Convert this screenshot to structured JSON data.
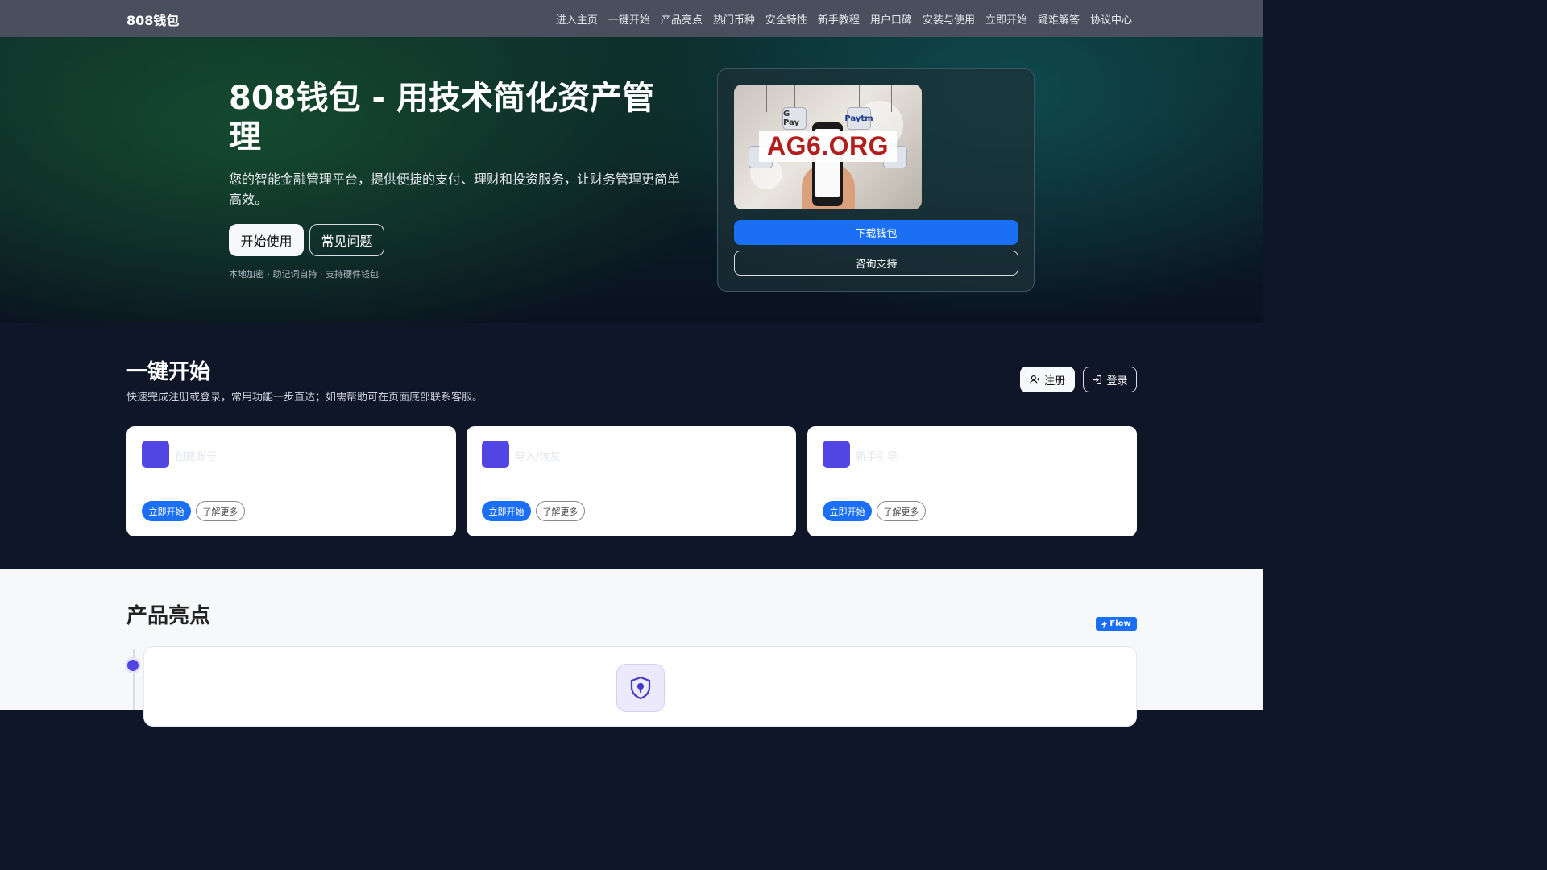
{
  "nav": {
    "brand": "808钱包",
    "links": [
      "进入主页",
      "一键开始",
      "产品亮点",
      "热门币种",
      "安全特性",
      "新手教程",
      "用户口碑",
      "安装与使用",
      "立即开始",
      "疑难解答",
      "协议中心"
    ]
  },
  "hero": {
    "title": "808钱包 - 用技术简化资产管理",
    "subtitle": "您的智能金融管理平台，提供便捷的支付、理财和投资服务，让财务管理更简单高效。",
    "start_label": "开始使用",
    "faq_label": "常见问题",
    "note": "本地加密 · 助记词自持 · 支持硬件钱包",
    "card": {
      "image_tags": [
        "G Pay",
        "Paytm"
      ],
      "watermark": "AG6.ORG",
      "download_label": "下载钱包",
      "support_label": "咨询支持"
    }
  },
  "quick": {
    "title": "一键开始",
    "description": "快速完成注册或登录，常用功能一步直达；如需帮助可在页面底部联系客服。",
    "register_label": "注册",
    "login_label": "登录",
    "cards": [
      {
        "title": "创建账号",
        "primary": "立即开始",
        "secondary": "了解更多"
      },
      {
        "title": "导入/恢复",
        "primary": "立即开始",
        "secondary": "了解更多"
      },
      {
        "title": "新手引导",
        "primary": "立即开始",
        "secondary": "了解更多"
      }
    ]
  },
  "highlights": {
    "title": "产品亮点",
    "badge": "Flow"
  },
  "icons": {
    "register": "user-plus-icon",
    "login": "sign-in-icon",
    "flow": "lightning-icon",
    "highlight": "shield-lock-icon"
  },
  "colors": {
    "accent": "#1a6ff5",
    "card_icon": "#5146e3",
    "nav_bg": "#4a4f5e",
    "dark_bg": "#0e1628"
  }
}
